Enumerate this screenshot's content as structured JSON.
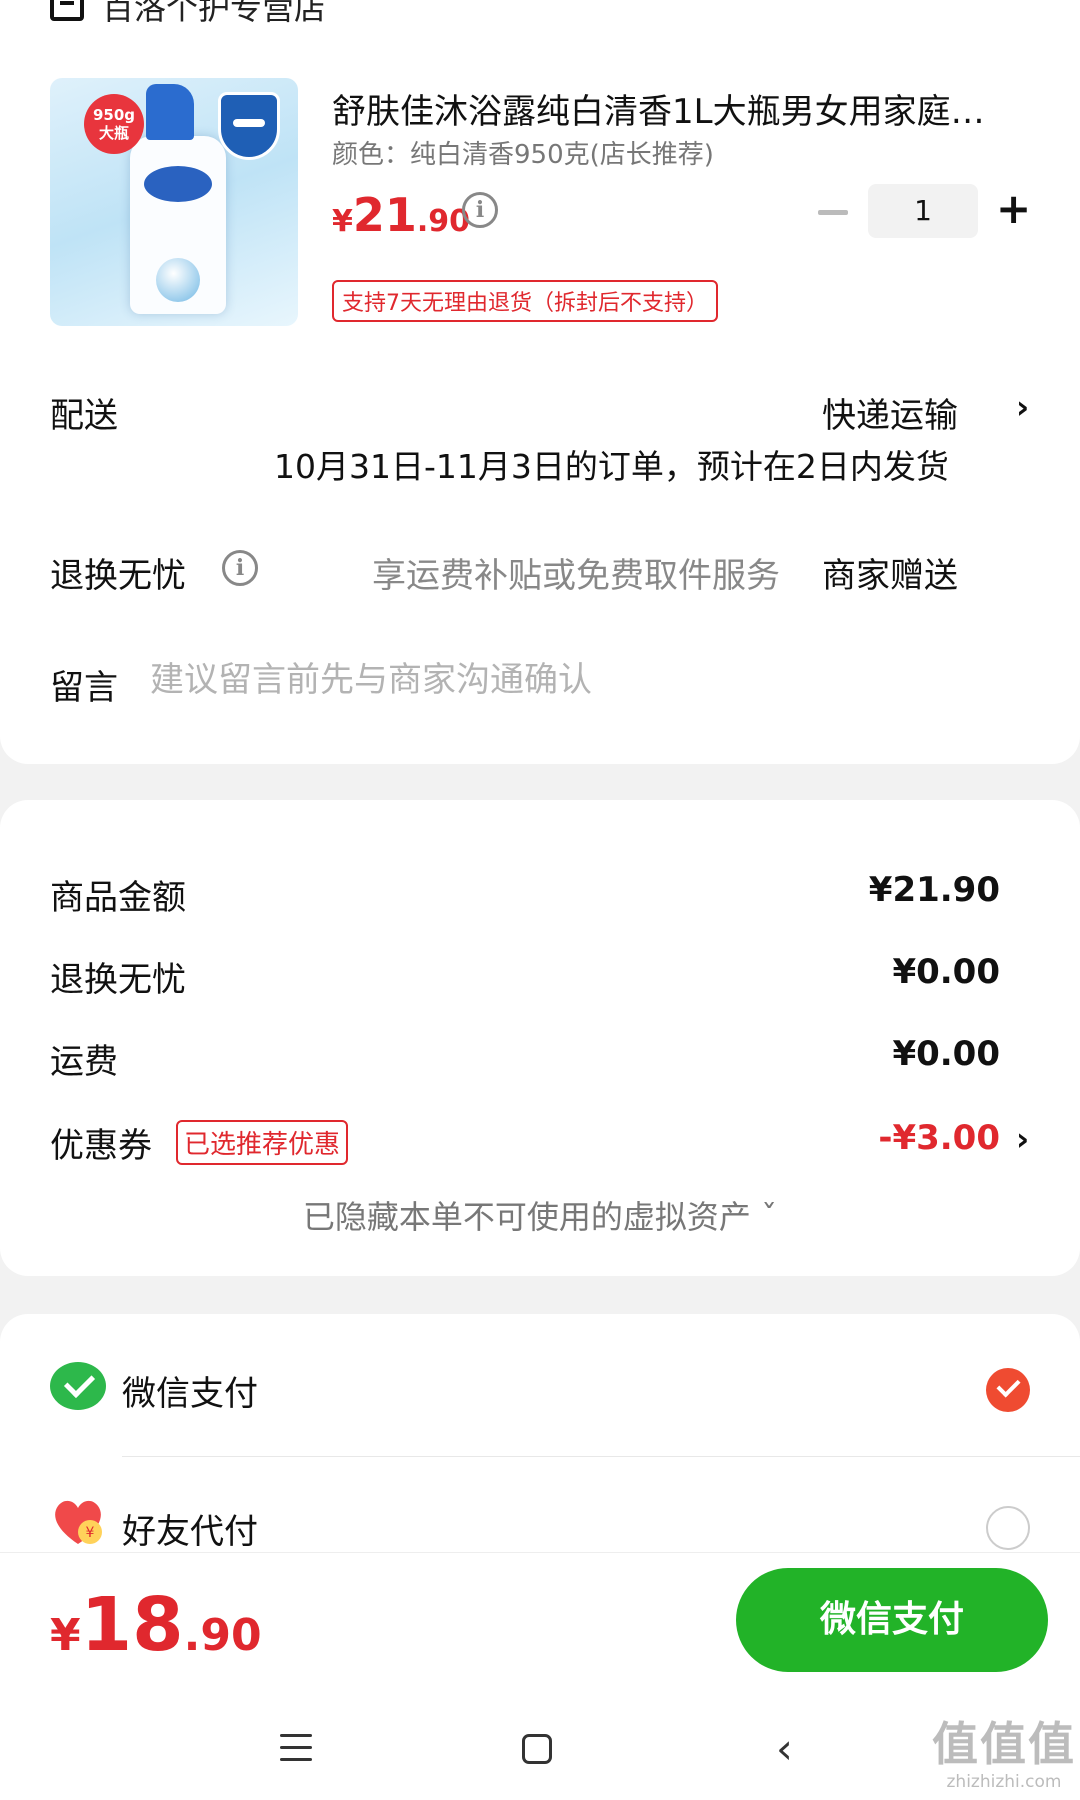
{
  "store": {
    "name": "百洛个护专营店",
    "icon": "store-icon"
  },
  "product": {
    "title": "舒肤佳沐浴露纯白清香1L大瓶男女用家庭…",
    "spec": "颜色：纯白清香950克(店长推荐)",
    "image_icon": "product-bottle-image",
    "image_badge": "950g\n大瓶",
    "price": {
      "currency": "¥",
      "int": "21",
      "dec": ".90"
    },
    "quantity": "1",
    "return_tag": "支持7天无理由退货（拆封后不支持）"
  },
  "delivery": {
    "label": "配送",
    "method": "快递运输",
    "note": "10月31日-11月3日的订单，预计在2日内发货"
  },
  "worry_free": {
    "label": "退换无忧",
    "desc": "享运费补贴或免费取件服务",
    "gift": "商家赠送"
  },
  "message": {
    "label": "留言",
    "placeholder": "建议留言前先与商家沟通确认"
  },
  "summary": {
    "items_label": "商品金额",
    "items_value": "¥21.90",
    "worry_label": "退换无忧",
    "worry_value": "¥0.00",
    "shipping_label": "运费",
    "shipping_value": "¥0.00",
    "coupon_label": "优惠券",
    "coupon_tag": "已选推荐优惠",
    "coupon_value": "-¥3.00",
    "hidden_assets": "已隐藏本单不可使用的虚拟资产 ˇ"
  },
  "payment": {
    "wechat_label": "微信支付",
    "wechat_selected": true,
    "friend_label": "好友代付",
    "friend_selected": false
  },
  "checkout": {
    "total": {
      "currency": "¥",
      "int": "18",
      "dec": ".90"
    },
    "pay_button": "微信支付"
  },
  "watermark": {
    "logo": "值值值",
    "url": "zhizhizhi.com"
  },
  "colors": {
    "price_red": "#e0282e",
    "wechat_green": "#22b328",
    "check_orange": "#ef4b31"
  }
}
